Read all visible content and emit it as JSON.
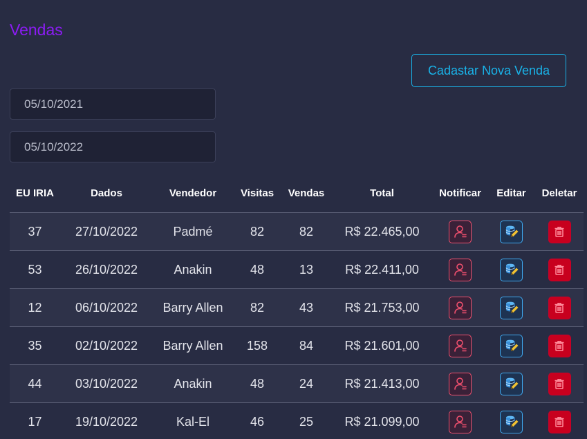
{
  "page": {
    "title": "Vendas",
    "new_sale_label": "Cadastar Nova Venda"
  },
  "filters": {
    "start_date": "05/10/2021",
    "end_date": "05/10/2022"
  },
  "table": {
    "headers": [
      "EU IRIA",
      "Dados",
      "Vendedor",
      "Visitas",
      "Vendas",
      "Total",
      "Notificar",
      "Editar",
      "Deletar"
    ],
    "rows": [
      {
        "id": "37",
        "date": "27/10/2022",
        "seller": "Padmé",
        "visits": "82",
        "sales": "82",
        "total": "R$ 22.465,00"
      },
      {
        "id": "53",
        "date": "26/10/2022",
        "seller": "Anakin",
        "visits": "48",
        "sales": "13",
        "total": "R$ 22.411,00"
      },
      {
        "id": "12",
        "date": "06/10/2022",
        "seller": "Barry Allen",
        "visits": "82",
        "sales": "43",
        "total": "R$ 21.753,00"
      },
      {
        "id": "35",
        "date": "02/10/2022",
        "seller": "Barry Allen",
        "visits": "158",
        "sales": "84",
        "total": "R$ 21.601,00"
      },
      {
        "id": "44",
        "date": "03/10/2022",
        "seller": "Anakin",
        "visits": "48",
        "sales": "24",
        "total": "R$ 21.413,00"
      },
      {
        "id": "17",
        "date": "19/10/2022",
        "seller": "Kal-El",
        "visits": "46",
        "sales": "25",
        "total": "R$ 21.099,00"
      }
    ],
    "row_actions": {
      "notify_icon": "user-notify-icon",
      "edit_icon": "database-edit-icon",
      "delete_icon": "trash-icon"
    }
  },
  "colors": {
    "background": "#282c43",
    "title": "#8c1cf5",
    "accent": "#19b4ea",
    "notify": "#f0506e",
    "edit": "#3fa8ef",
    "delete": "#c8001e"
  }
}
